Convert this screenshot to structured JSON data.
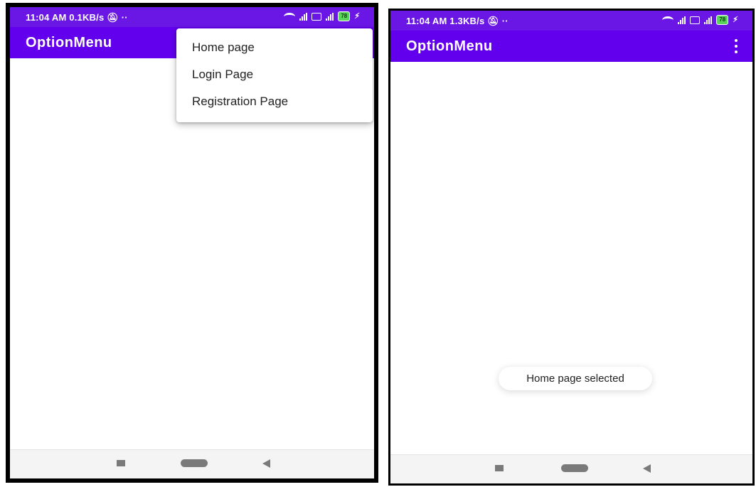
{
  "left": {
    "status_bar": {
      "time": "11:04 AM",
      "speed": "0.1KB/s",
      "battery": "78"
    },
    "app_bar": {
      "title": "OptionMenu"
    },
    "popup_menu": {
      "items": [
        "Home page",
        "Login Page",
        "Registration Page"
      ]
    }
  },
  "right": {
    "status_bar": {
      "time": "11:04 AM",
      "speed": "1.3KB/s",
      "battery": "78"
    },
    "app_bar": {
      "title": "OptionMenu"
    },
    "toast": "Home page selected"
  },
  "icons": {
    "status": [
      "mute-icon",
      "more-dots-icon",
      "wifi-icon",
      "signal-icon",
      "sim-icon",
      "signal-4g-icon",
      "battery-icon",
      "charging-icon"
    ],
    "app_bar": "overflow-menu-icon",
    "nav": [
      "recent-apps-icon",
      "home-icon",
      "back-icon"
    ]
  },
  "colors": {
    "status_bar": "#6a17e6",
    "app_bar": "#6200ee",
    "battery": "#5bd45b"
  }
}
